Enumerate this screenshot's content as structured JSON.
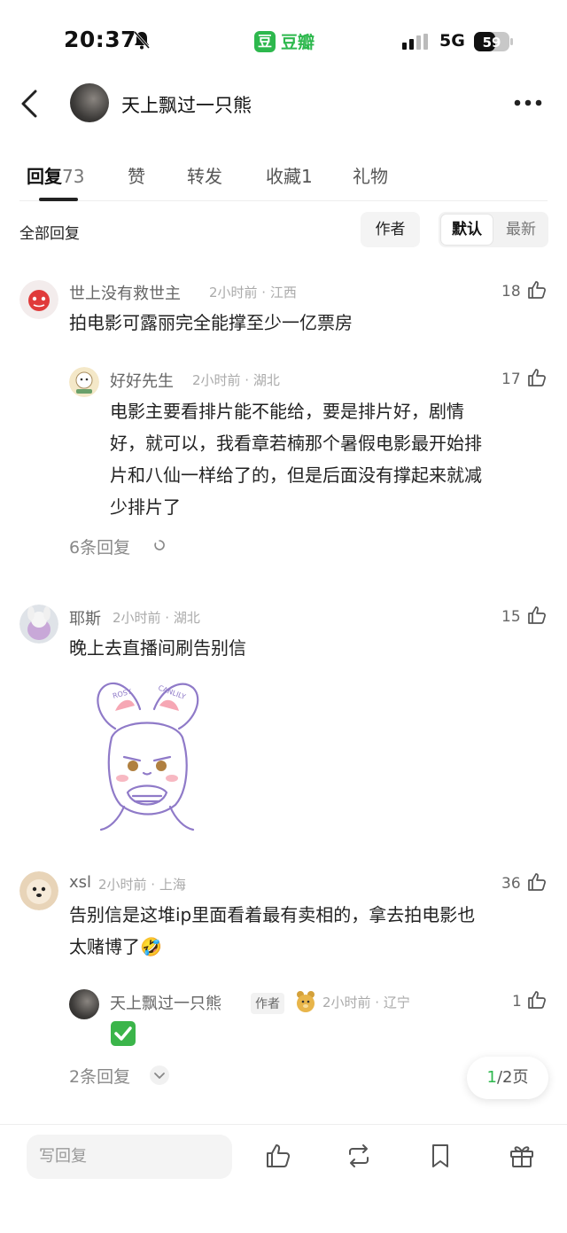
{
  "status": {
    "time": "20:37",
    "app_name": "豆瓣",
    "app_logo": "豆",
    "network": "5G",
    "battery": "59"
  },
  "header": {
    "title": "天上飘过一只熊"
  },
  "tabs": [
    {
      "label": "回复",
      "count": "73"
    },
    {
      "label": "赞",
      "count": ""
    },
    {
      "label": "转发",
      "count": ""
    },
    {
      "label": "收藏",
      "count": "1"
    },
    {
      "label": "礼物",
      "count": ""
    }
  ],
  "filter": {
    "all_label": "全部回复",
    "author_label": "作者",
    "sort_default": "默认",
    "sort_latest": "最新"
  },
  "comments": [
    {
      "user": "世上没有救世主",
      "meta": "2小时前 · 江西",
      "likes": "18",
      "text": "拍电影可露丽完全能撑至少一亿票房",
      "reply": {
        "user": "好好先生",
        "meta": "2小时前 · 湖北",
        "likes": "17",
        "lines": [
          "电影主要看排片能不能给，要是排片好，剧情",
          "好，就可以，我看章若楠那个暑假电影最开始排",
          "片和八仙一样给了的，但是后面没有撑起来就减",
          "少排片了"
        ]
      },
      "replies_label": "6条回复"
    },
    {
      "user": "耶斯",
      "meta": "2小时前 · 湖北",
      "likes": "15",
      "text": "晚上去直播间刷告别信",
      "sticker_text": [
        "ROSY",
        "CANLILY"
      ]
    },
    {
      "user": "xsl",
      "meta": "2小时前 · 上海",
      "likes": "36",
      "lines": [
        "告别信是这堆ip里面看着最有卖相的，拿去拍电影也",
        "太赌博了🤣"
      ],
      "reply": {
        "user": "天上飘过一只熊",
        "author_tag": "作者",
        "meta": "2小时前 · 辽宁",
        "likes": "1",
        "text": "✅"
      },
      "replies_label": "2条回复"
    }
  ],
  "pagination": {
    "current": "1",
    "total": "/2页"
  },
  "bottom_bar": {
    "reply_placeholder": "写回复"
  },
  "colors": {
    "accent": "#2db84d",
    "text": "#222222",
    "muted": "#999999"
  }
}
